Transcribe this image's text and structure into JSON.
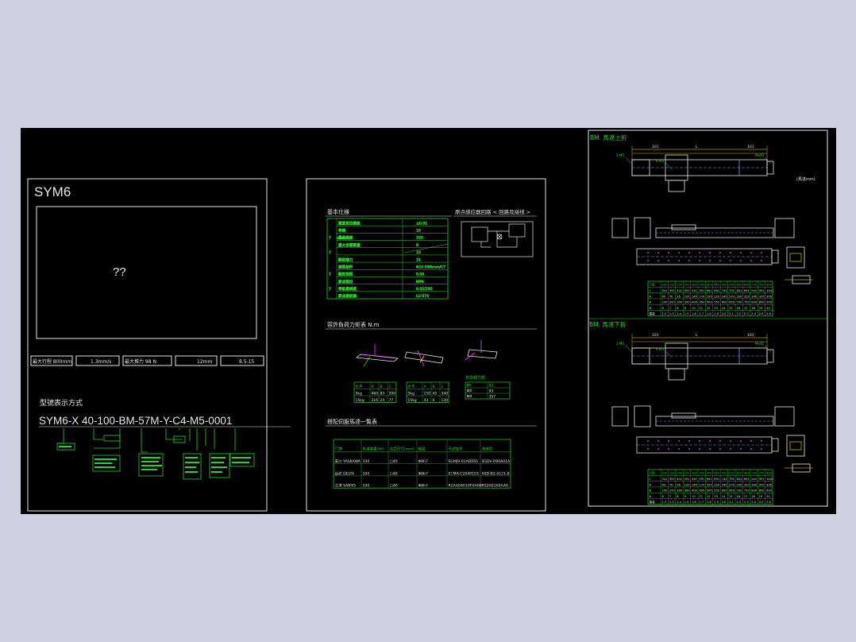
{
  "colors": {
    "page_bg": "#cfd0e2",
    "canvas_bg": "#000000",
    "frame": "#ffffff",
    "line_green": "#2bd22b",
    "line_white": "#e6e6e6",
    "hatch_blue": "#7f9cff",
    "accent_magenta": "#ff3cff",
    "accent_yellow": "#ffea00"
  },
  "sheet1": {
    "title": "SYM6",
    "placeholder": "??",
    "model_heading": "型號表示方式",
    "model_code": "SYM6-X 40-100-BM-57M-Y-C4-M5-0001",
    "spec_boxes": [
      "最大行程 800mm",
      "1.3mm/s",
      "最大推力 98 N",
      "12mm",
      "8.5-15"
    ]
  },
  "sheet2": {
    "spec_heading": "基本仕様",
    "wiring_heading": "原点感应器回路 < 回路及接线 >",
    "moment_heading": "容許負荷力矩表 N.m",
    "servo_heading": "搭配伺服馬達一覧表",
    "spec_rows": [
      [
        "",
        "",
        "重复定位精度",
        "±0.01"
      ],
      [
        "",
        "",
        "导程",
        "10"
      ],
      [
        "?",
        "mm/s",
        "最高速度",
        "330"
      ],
      [
        "",
        "",
        "最大负载重量",
        "9"
      ],
      [
        "?",
        "",
        "",
        "10"
      ],
      [
        "",
        "",
        "额定推力",
        "31"
      ],
      [
        "",
        "",
        "滚珠丝杆",
        "Φ10 DB6mm/C7"
      ],
      [
        "?",
        "",
        "额定扭矩",
        "0.59"
      ],
      [
        "",
        "",
        "原点检出",
        "NPN"
      ],
      [
        "?",
        "",
        "导轨直线度",
        "0.02/200"
      ],
      [
        "",
        "",
        "原点感应器",
        "LU-574"
      ]
    ],
    "servo_cols": [
      "厂牌",
      "馬達容量(W)",
      "法兰尺寸(mm)",
      "轴径",
      "马达型号",
      "减速机"
    ],
    "servo_rows": [
      [
        "安川 YASKAWA",
        "100",
        "□40",
        "Φ8h7",
        "SGMJV-01ADE6S",
        "SGDV-R90A01A"
      ],
      [
        "台达 DELTA",
        "100",
        "□40",
        "Φ8h7",
        "ECMA-C20401ES",
        "ASD-B2-0121-B"
      ],
      [
        "三洋 SANYO",
        "100",
        "□40",
        "Φ8h7",
        "R2AA04010FXH00",
        "RS2A01A0AA0"
      ]
    ],
    "moment_cols": [
      "水平",
      "A",
      "B",
      "C"
    ],
    "moment_rows": [
      [
        "5kg",
        "460",
        "83",
        "200"
      ],
      [
        "15kg",
        "316",
        "24",
        "77"
      ]
    ],
    "moment_rows_wall": [
      [
        "5kg",
        "150",
        "45",
        "340"
      ],
      [
        "15kg",
        "43",
        "0",
        "130"
      ]
    ],
    "static_moment": [
      [
        "MY",
        "83"
      ],
      [
        "MP",
        "93"
      ],
      [
        "MR",
        "357"
      ]
    ]
  },
  "sheet3": {
    "top_heading": "BM. 馬達上折",
    "bottom_heading": "BM. 馬達下折",
    "motor_note": "(馬達mm)",
    "dim_labels": [
      "101",
      "L",
      "有效行程",
      "101",
      "117",
      "Mx40",
      "2-M5",
      "4-M3",
      "35",
      "40"
    ],
    "table_header": [
      "行程",
      "100",
      "150",
      "200",
      "250",
      "300",
      "350",
      "400",
      "450",
      "500",
      "550",
      "600",
      "650",
      "700",
      "750",
      "800"
    ],
    "table_rows": [
      [
        "L",
        "341",
        "391",
        "441",
        "491",
        "541",
        "591",
        "641",
        "691",
        "741",
        "791",
        "841",
        "891",
        "941",
        "991",
        "1041"
      ],
      [
        "A",
        "45",
        "70",
        "95",
        "120",
        "145",
        "170",
        "195",
        "220",
        "245",
        "270",
        "295",
        "320",
        "345",
        "370",
        "395"
      ],
      [
        "B",
        "200",
        "250",
        "300",
        "350",
        "400",
        "450",
        "500",
        "550",
        "600",
        "650",
        "700",
        "750",
        "800",
        "850",
        "900"
      ],
      [
        "N",
        "6",
        "7",
        "8",
        "9",
        "10",
        "11",
        "12",
        "13",
        "14",
        "15",
        "16",
        "17",
        "18",
        "19",
        "20"
      ],
      [
        "重量",
        "1.2",
        "1.3",
        "1.4",
        "1.5",
        "1.6",
        "1.7",
        "1.8",
        "1.9",
        "2.0",
        "2.1",
        "2.2",
        "2.3",
        "2.4",
        "2.5",
        "2.6"
      ]
    ]
  }
}
